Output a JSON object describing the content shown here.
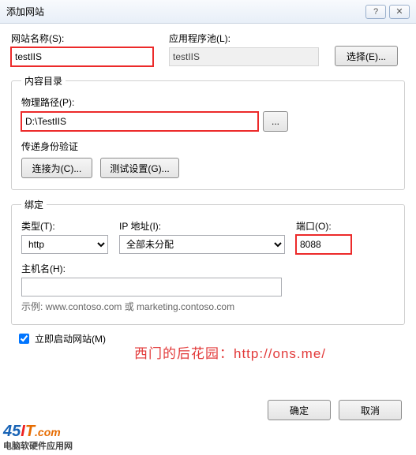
{
  "titlebar": {
    "title": "添加网站",
    "help": "?",
    "close": "✕"
  },
  "site": {
    "name_label": "网站名称(S):",
    "name_value": "testIIS",
    "apppool_label": "应用程序池(L):",
    "apppool_value": "testIIS",
    "select_btn": "选择(E)..."
  },
  "contentdir": {
    "legend": "内容目录",
    "physpath_label": "物理路径(P):",
    "physpath_value": "D:\\TestIIS",
    "browse_btn": "...",
    "passthrough_label": "传递身份验证",
    "connectas_btn": "连接为(C)...",
    "testsettings_btn": "测试设置(G)..."
  },
  "binding": {
    "legend": "绑定",
    "type_label": "类型(T):",
    "type_value": "http",
    "ip_label": "IP 地址(I):",
    "ip_value": "全部未分配",
    "port_label": "端口(O):",
    "port_value": "8088",
    "host_label": "主机名(H):",
    "host_value": "",
    "example": "示例: www.contoso.com 或 marketing.contoso.com"
  },
  "startnow": {
    "label": "立即启动网站(M)",
    "checked": true
  },
  "footer": {
    "ok": "确定",
    "cancel": "取消"
  },
  "watermark": "西门的后花园：http://ons.me/",
  "logo": {
    "sub": "电脑软硬件应用网"
  }
}
